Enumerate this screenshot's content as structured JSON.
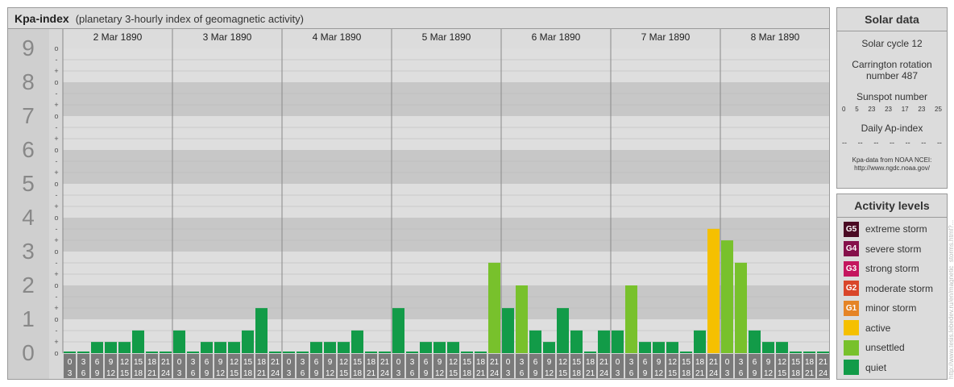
{
  "title": {
    "main": "Kpa-index",
    "sub": "(planetary 3-hourly index of geomagnetic activity)"
  },
  "chart_data": {
    "type": "bar",
    "title": "Kpa-index",
    "subtitle": "(planetary 3-hourly index of geomagnetic activity)",
    "ylim": [
      0,
      9
    ],
    "y_major_labels": [
      "0",
      "1",
      "2",
      "3",
      "4",
      "5",
      "6",
      "7",
      "8",
      "9"
    ],
    "y_minor_marks": [
      "-",
      "o",
      "+"
    ],
    "days": [
      "2 Mar 1890",
      "3 Mar 1890",
      "4 Mar 1890",
      "5 Mar 1890",
      "6 Mar 1890",
      "7 Mar 1890",
      "8 Mar 1890"
    ],
    "intervals": [
      [
        "0",
        "3"
      ],
      [
        "3",
        "6"
      ],
      [
        "6",
        "9"
      ],
      [
        "9",
        "12"
      ],
      [
        "12",
        "15"
      ],
      [
        "15",
        "18"
      ],
      [
        "18",
        "21"
      ],
      [
        "21",
        "24"
      ]
    ],
    "values": [
      [
        0,
        0,
        0.33,
        0.33,
        0.33,
        0.67,
        0,
        0
      ],
      [
        0.67,
        0,
        0.33,
        0.33,
        0.33,
        0.67,
        1.33,
        0
      ],
      [
        0,
        0,
        0.33,
        0.33,
        0.33,
        0.67,
        0,
        0
      ],
      [
        1.33,
        0,
        0.33,
        0.33,
        0.33,
        0,
        0,
        2.67
      ],
      [
        1.33,
        2,
        0.67,
        0.33,
        1.33,
        0.67,
        0,
        0.67
      ],
      [
        0.67,
        2,
        0.33,
        0.33,
        0.33,
        0,
        0.67,
        3.67
      ],
      [
        3.33,
        2.67,
        0.67,
        0.33,
        0.33,
        0,
        0,
        0
      ]
    ],
    "level_colors": {
      "quiet": "#129b48",
      "unsettled": "#78c12c",
      "active": "#f5c000"
    }
  },
  "solar_data": {
    "title": "Solar data",
    "cycle": "Solar cycle 12",
    "carrington_line1": "Carrington rotation",
    "carrington_line2": "number 487",
    "sunspot_label": "Sunspot number",
    "sunspot_values": [
      "0",
      "5",
      "23",
      "23",
      "17",
      "23",
      "25"
    ],
    "ap_label": "Daily Ap-index",
    "ap_values": [
      "--",
      "--",
      "--",
      "--",
      "--",
      "--",
      "--"
    ],
    "credit_line1": "Kpa-data from NOAA NCEI:",
    "credit_line2": "http://www.ngdc.noaa.gov/"
  },
  "activity_levels": {
    "title": "Activity levels",
    "items": [
      {
        "badge": "G5",
        "label": "extreme storm",
        "color": "#4a0a23"
      },
      {
        "badge": "G4",
        "label": "severe storm",
        "color": "#85104a"
      },
      {
        "badge": "G3",
        "label": "strong storm",
        "color": "#c4165e"
      },
      {
        "badge": "G2",
        "label": "moderate storm",
        "color": "#d9462a"
      },
      {
        "badge": "G1",
        "label": "minor storm",
        "color": "#e58426"
      },
      {
        "badge": "",
        "label": "active",
        "color": "#f5c000"
      },
      {
        "badge": "",
        "label": "unsettled",
        "color": "#78c12c"
      },
      {
        "badge": "",
        "label": "quiet",
        "color": "#129b48"
      }
    ]
  },
  "watermark": "http://www.tesis.lebedev.ru/en/magnetic_storms.html?..."
}
